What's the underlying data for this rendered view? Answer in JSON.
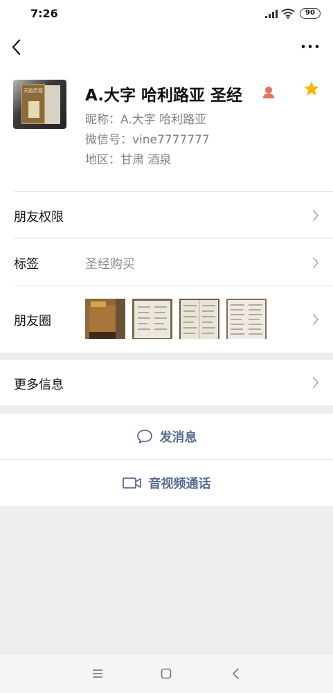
{
  "status": {
    "time": "7:26",
    "battery": "90"
  },
  "profile": {
    "name": "A.大字 哈利路亚 圣经",
    "nickname": "昵称：A.大字 哈利路亚",
    "wechat_id": "微信号：vine7777777",
    "region": "地区：甘肃  酒泉",
    "avatar_text": "天路历程"
  },
  "rows": {
    "permissions": "朋友权限",
    "tags_label": "标签",
    "tags_value": "圣经购买",
    "moments": "朋友圈",
    "more_info": "更多信息"
  },
  "actions": {
    "message": "发消息",
    "video_call": "音视频通话"
  },
  "colors": {
    "link": "#576b95",
    "star": "#f5b800",
    "gender": "#e8735a"
  }
}
